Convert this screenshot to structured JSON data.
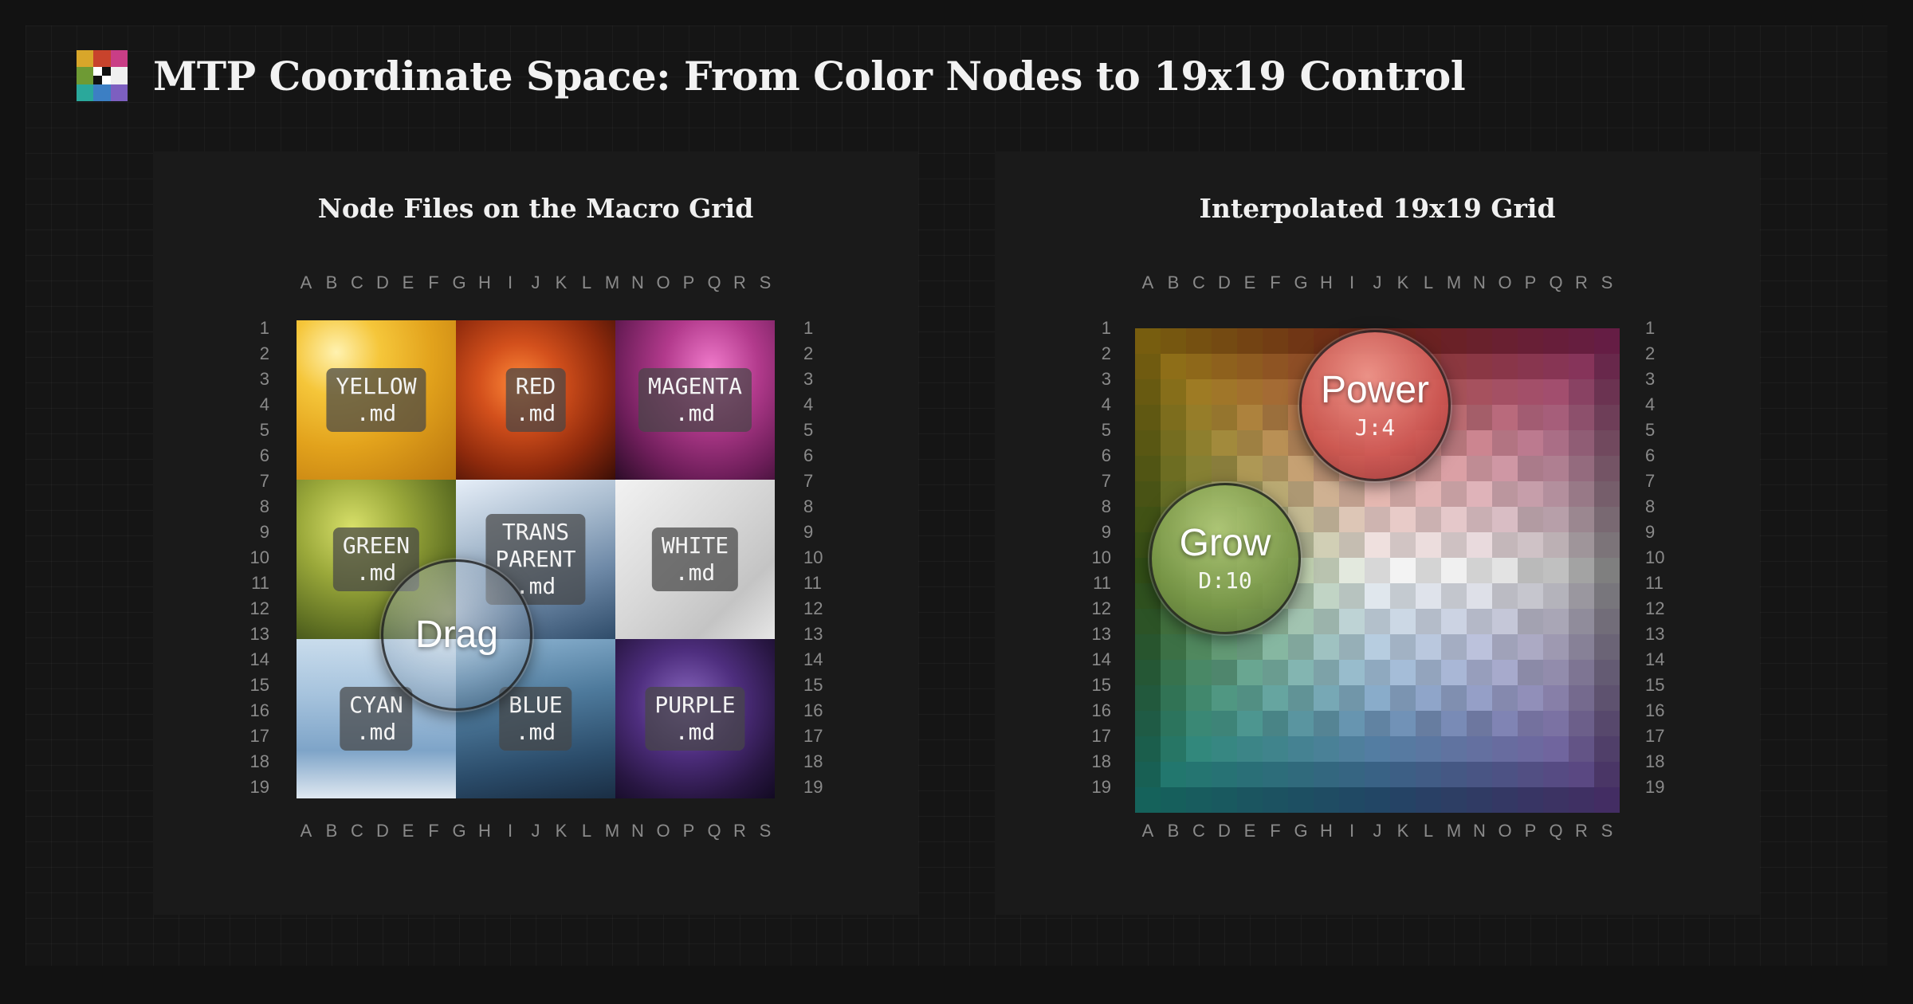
{
  "header": {
    "title": "MTP Coordinate Space: From Color Nodes to 19x19 Control",
    "logo_icon": "color-grid-logo-icon"
  },
  "columns": [
    "A",
    "B",
    "C",
    "D",
    "E",
    "F",
    "G",
    "H",
    "I",
    "J",
    "K",
    "L",
    "M",
    "N",
    "O",
    "P",
    "Q",
    "R",
    "S"
  ],
  "rows": [
    "1",
    "2",
    "3",
    "4",
    "5",
    "6",
    "7",
    "8",
    "9",
    "10",
    "11",
    "12",
    "13",
    "14",
    "15",
    "16",
    "17",
    "18",
    "19"
  ],
  "left_panel": {
    "title": "Node Files on the Macro Grid",
    "nodes": [
      {
        "name": "yellow",
        "label": "YELLOW\n.md",
        "color": "#e9a81f"
      },
      {
        "name": "red",
        "label": "RED\n.md",
        "color": "#b8421a"
      },
      {
        "name": "magenta",
        "label": "MAGENTA\n.md",
        "color": "#a8347c"
      },
      {
        "name": "green",
        "label": "GREEN\n.md",
        "color": "#7d8a2e"
      },
      {
        "name": "transparent",
        "label": "TRANS\nPARENT\n.md",
        "color": "#a9b8cc"
      },
      {
        "name": "white",
        "label": "WHITE\n.md",
        "color": "#d4d4d4"
      },
      {
        "name": "cyan",
        "label": "CYAN\n.md",
        "color": "#8fb0cf"
      },
      {
        "name": "blue",
        "label": "BLUE\n.md",
        "color": "#4a6f90"
      },
      {
        "name": "purple",
        "label": "PURPLE\n.md",
        "color": "#4a2c6e"
      }
    ],
    "drag_lens": {
      "label": "Drag"
    }
  },
  "right_panel": {
    "title": "Interpolated 19x19 Grid",
    "corner_colors": {
      "top_left": "#d9a91c",
      "top": "#c6402c",
      "top_right": "#b8357c",
      "left": "#5b8f2a",
      "center": "#f4f4f4",
      "right": "#e7e7e7",
      "bottom_left": "#26b2a6",
      "bottom": "#3d7fb8",
      "bottom_right": "#7a52b4"
    },
    "power_lens": {
      "label": "Power",
      "sub": "J:4"
    },
    "grow_lens": {
      "label": "Grow",
      "sub": "D:10"
    }
  }
}
